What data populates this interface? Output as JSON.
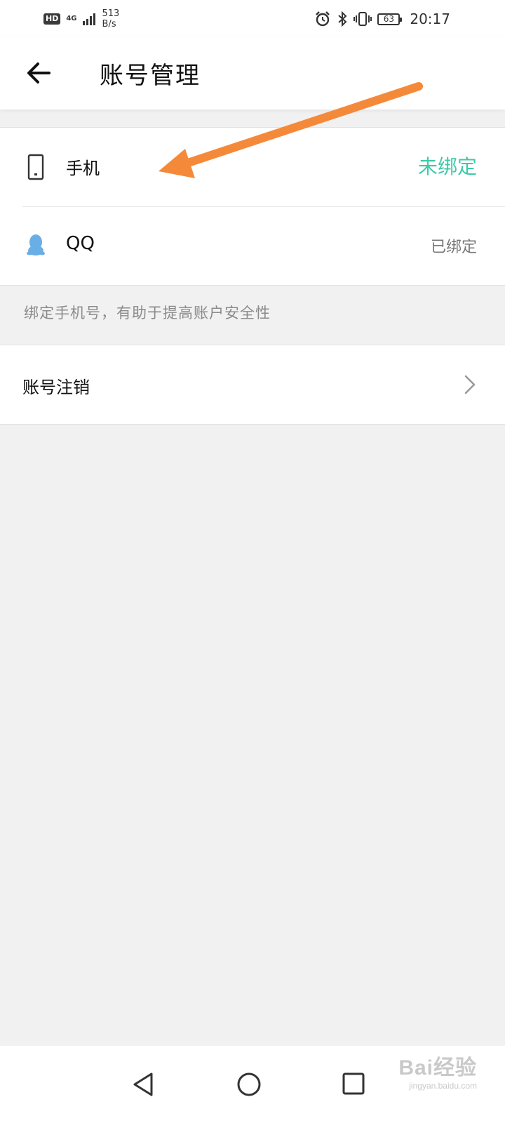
{
  "status_bar": {
    "hd": "HD",
    "network": "4G",
    "speed_value": "513",
    "speed_unit": "B/s",
    "battery": "63",
    "time": "20:17"
  },
  "header": {
    "title": "账号管理"
  },
  "bindings": [
    {
      "label": "手机",
      "status": "未绑定",
      "icon": "phone-icon"
    },
    {
      "label": "QQ",
      "status": "已绑定",
      "icon": "qq-penguin-icon"
    }
  ],
  "hint": "绑定手机号，有助于提高账户安全性",
  "account_cancel": {
    "label": "账号注销"
  },
  "watermark": {
    "logo": "Bai经验",
    "url": "jingyan.baidu.com"
  },
  "colors": {
    "unbound_status": "#3ccaa8",
    "annotation_arrow": "#f5893a",
    "qq_icon": "#6aaee6"
  }
}
